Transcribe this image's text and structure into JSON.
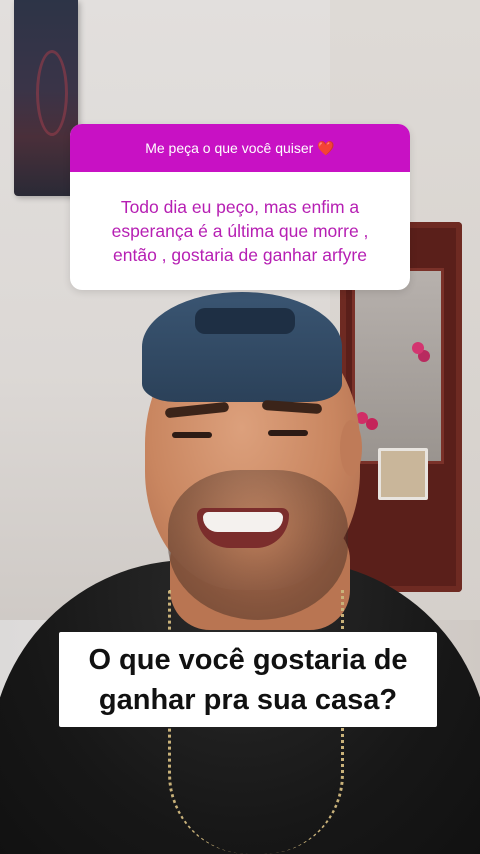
{
  "question_box": {
    "header": "Me peça o que você quiser",
    "heart_emoji": "❤️",
    "answer": "Todo dia eu peço, mas enfim a esperança é a última que morre , então , gostaria de ganhar arfyre"
  },
  "caption": {
    "text": "O que você gostaria de ganhar pra sua casa?"
  },
  "colors": {
    "question_header_bg": "#c811c4",
    "question_answer_text": "#b61fb3",
    "caption_bg": "#ffffff",
    "caption_text": "#111111"
  }
}
